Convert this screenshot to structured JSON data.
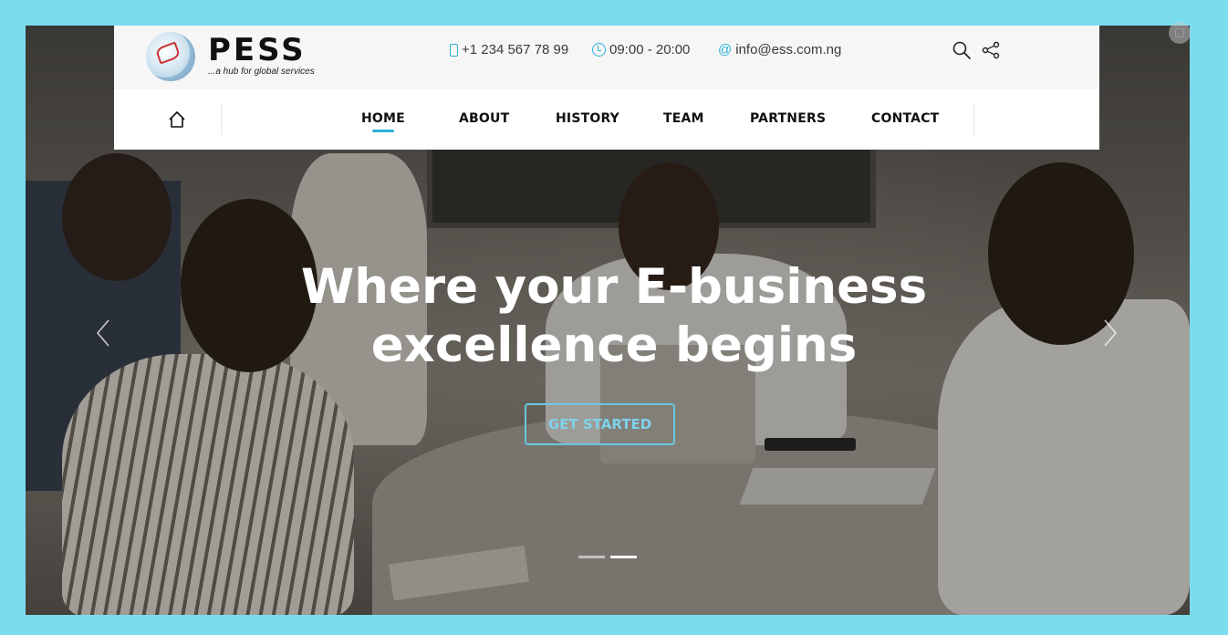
{
  "brand": {
    "name": "PESS",
    "tagline": "...a hub for global services"
  },
  "contact": {
    "phone": "+1 234 567 78 99",
    "hours": "09:00 - 20:00",
    "email": "info@ess.com.ng"
  },
  "nav": {
    "items": [
      {
        "label": "HOME",
        "active": true
      },
      {
        "label": "ABOUT"
      },
      {
        "label": "HISTORY"
      },
      {
        "label": "TEAM"
      },
      {
        "label": "PARTNERS"
      },
      {
        "label": "CONTACT"
      }
    ]
  },
  "hero": {
    "title_line1": "Where your E-business",
    "title_line2": "excellence begins",
    "cta_label": "GET STARTED"
  },
  "slider": {
    "slide_count": 2,
    "active_slide": 2
  },
  "colors": {
    "accent": "#2bb2d9",
    "page_background": "#7bdcf0"
  }
}
